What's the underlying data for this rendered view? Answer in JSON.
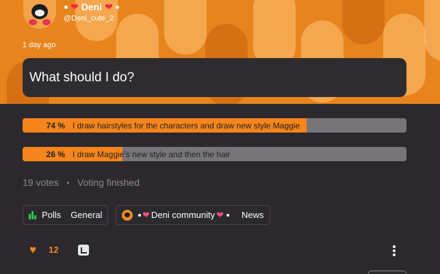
{
  "header": {
    "username": "Deni",
    "handle": "@Deni_cute_2",
    "posted_time": "1 day ago",
    "heart_glyph": "❤"
  },
  "poll": {
    "question": "What should I do?",
    "options": [
      {
        "percent_label": "74 %",
        "percent": 74,
        "text": "I draw hairstyles for the characters and draw new style Maggie"
      },
      {
        "percent_label": "26 %",
        "percent": 26,
        "text": "I draw Maggie's new style and then the hair"
      }
    ],
    "votes": "19 votes",
    "status": "Voting finished"
  },
  "tags": {
    "polls": {
      "label": "Polls",
      "icon": "bar-chart-icon",
      "category": "General"
    },
    "community": {
      "label": "Deni community",
      "icon": "community-avatar-icon",
      "category": "News"
    }
  },
  "actions": {
    "like_count": "12",
    "like_icon": "heart-icon",
    "reply_icon": "reply-icon",
    "more_icon": "more-vertical-icon"
  },
  "colors": {
    "accent": "#f7851b",
    "banner": "#e8841d",
    "background": "#2b292d",
    "bar_track": "#77757a",
    "heart": "#ef2b3e"
  }
}
